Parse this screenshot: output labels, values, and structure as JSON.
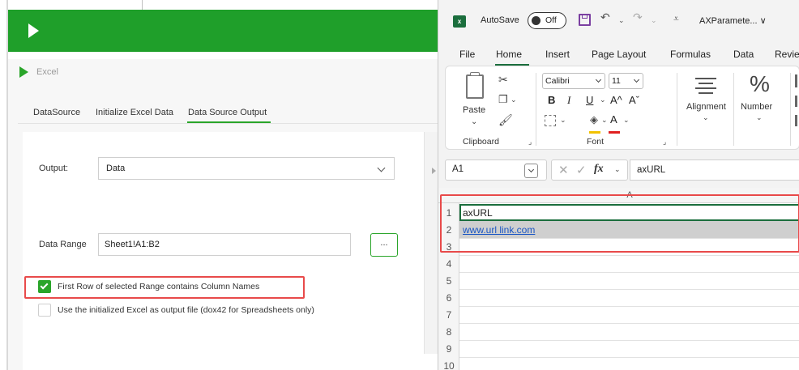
{
  "designer": {
    "panel_title": "Excel",
    "tabs": [
      "DataSource",
      "Initialize Excel Data",
      "Data Source Output"
    ],
    "output_label": "Output:",
    "output_value": "Data",
    "range_label": "Data Range",
    "range_value": "Sheet1!A1:B2",
    "browse_label": "...",
    "checkbox_first_row": "First Row of selected Range contains Column Names",
    "checkbox_use_initialized": "Use the initialized Excel as output file (dox42 for Spreadsheets only)"
  },
  "excel": {
    "logo": "x",
    "autosave_label": "AutoSave",
    "autosave_state": "Off",
    "title": "AXParamete... ∨",
    "menu": [
      "File",
      "Home",
      "Insert",
      "Page Layout",
      "Formulas",
      "Data",
      "Revie"
    ],
    "ribbon": {
      "paste_label": "Paste",
      "clipboard_label": "Clipboard",
      "font_name": "Calibri",
      "font_size": "11",
      "bold": "B",
      "italic": "I",
      "underline": "U",
      "grow_font": "A^",
      "shrink_font": "Aˇ",
      "font_color_glyph": "A",
      "font_group_label": "Font",
      "alignment_label": "Alignment",
      "number_label": "Number",
      "percent_glyph": "%"
    },
    "name_box": "A1",
    "fx_symbol": "fx",
    "formula_value": "axURL",
    "column_header": "A",
    "row_numbers": [
      "1",
      "2",
      "3",
      "4",
      "5",
      "6",
      "7",
      "8",
      "9",
      "10"
    ],
    "cells": {
      "a1": "axURL",
      "a2": "www.url link.com"
    }
  },
  "colors": {
    "accent_green": "#1f9f2a",
    "excel_green": "#1b6e3d",
    "highlight_red": "#e84a4a",
    "link_blue": "#1a56c4"
  }
}
